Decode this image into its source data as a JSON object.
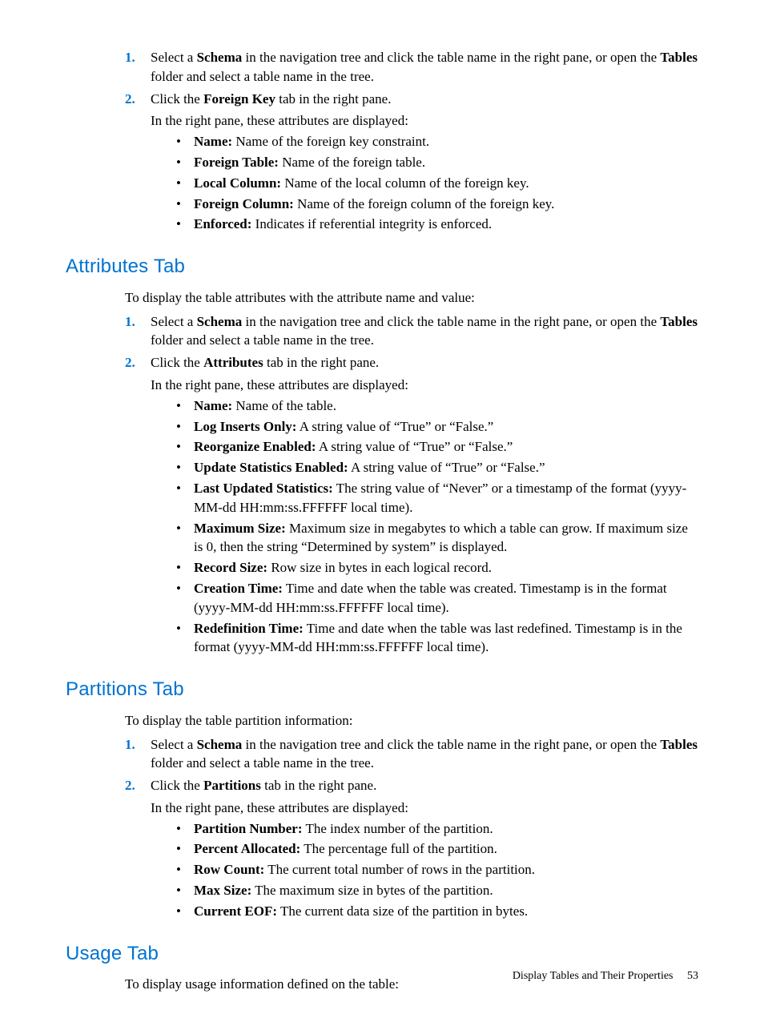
{
  "footer": {
    "title": "Display Tables and Their Properties",
    "page": "53"
  },
  "top": {
    "step1_pre": "Select a ",
    "step1_b1": "Schema",
    "step1_mid": " in the navigation tree and click the table name in the right pane, or open the ",
    "step1_b2": "Tables",
    "step1_post": " folder and select a table name in the tree.",
    "step2_pre": "Click the ",
    "step2_b": "Foreign Key",
    "step2_post": " tab in the right pane.",
    "subpara": "In the right pane, these attributes are displayed:",
    "attrs": [
      {
        "label": "Name:",
        "desc": " Name of the foreign key constraint."
      },
      {
        "label": "Foreign Table:",
        "desc": " Name of the foreign table."
      },
      {
        "label": "Local Column:",
        "desc": " Name of the local column of the foreign key."
      },
      {
        "label": "Foreign Column:",
        "desc": " Name of the foreign column of the foreign key."
      },
      {
        "label": "Enforced:",
        "desc": " Indicates if referential integrity is enforced."
      }
    ]
  },
  "attributes": {
    "heading": "Attributes Tab",
    "intro": "To display the table attributes with the attribute name and value:",
    "step1_pre": "Select a ",
    "step1_b1": "Schema",
    "step1_mid": " in the navigation tree and click the table name in the right pane, or open the ",
    "step1_b2": "Tables",
    "step1_post": " folder and select a table name in the tree.",
    "step2_pre": "Click the ",
    "step2_b": "Attributes",
    "step2_post": " tab in the right pane.",
    "subpara": "In the right pane, these attributes are displayed:",
    "attrs": [
      {
        "label": "Name:",
        "desc": " Name of the table."
      },
      {
        "label": "Log Inserts Only:",
        "desc": " A string value of “True” or “False.”"
      },
      {
        "label": "Reorganize Enabled:",
        "desc": " A string value of “True” or “False.”"
      },
      {
        "label": "Update Statistics Enabled:",
        "desc": " A string value of “True” or “False.”"
      },
      {
        "label": "Last Updated Statistics:",
        "desc": " The string value of “Never” or a timestamp of the format (yyyy-MM-dd HH:mm:ss.FFFFFF local time)."
      },
      {
        "label": "Maximum Size:",
        "desc": " Maximum size in megabytes to which a table can grow. If maximum size is 0, then the string “Determined by system” is displayed."
      },
      {
        "label": "Record Size:",
        "desc": " Row size in bytes in each logical record."
      },
      {
        "label": "Creation Time:",
        "desc": " Time and date when the table was created. Timestamp is in the format (yyyy-MM-dd HH:mm:ss.FFFFFF local time)."
      },
      {
        "label": "Redefinition Time:",
        "desc": " Time and date when the table was last redefined. Timestamp is in the format (yyyy-MM-dd HH:mm:ss.FFFFFF local time)."
      }
    ]
  },
  "partitions": {
    "heading": "Partitions Tab",
    "intro": "To display the table partition information:",
    "step1_pre": "Select a ",
    "step1_b1": "Schema",
    "step1_mid": " in the navigation tree and click the table name in the right pane, or open the ",
    "step1_b2": "Tables",
    "step1_post": " folder and select a table name in the tree.",
    "step2_pre": "Click the ",
    "step2_b": "Partitions",
    "step2_post": " tab in the right pane.",
    "subpara": "In the right pane, these attributes are displayed:",
    "attrs": [
      {
        "label": "Partition Number:",
        "desc": " The index number of the partition."
      },
      {
        "label": "Percent Allocated:",
        "desc": " The percentage full of the partition."
      },
      {
        "label": "Row Count:",
        "desc": " The current total number of rows in the partition."
      },
      {
        "label": "Max Size:",
        "desc": " The maximum size in bytes of the partition."
      },
      {
        "label": "Current EOF:",
        "desc": " The current data size of the partition in bytes."
      }
    ]
  },
  "usage": {
    "heading": "Usage Tab",
    "intro": "To display usage information defined on the table:"
  }
}
